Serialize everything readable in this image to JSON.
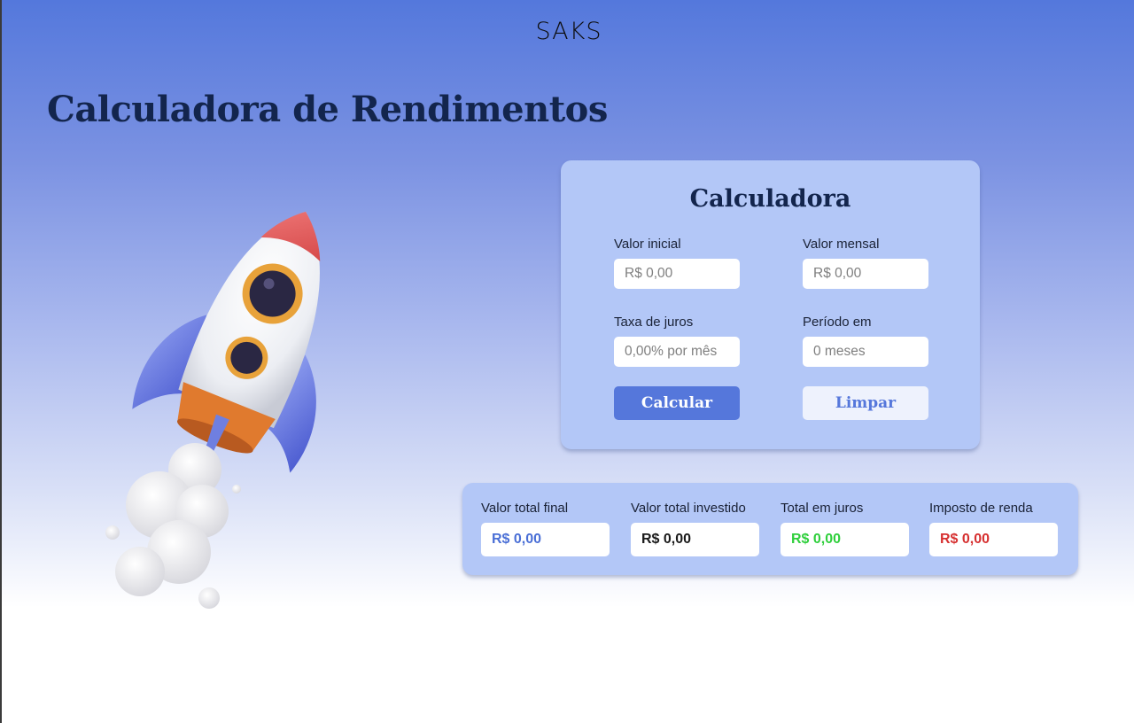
{
  "header": {
    "logo": "SAKS"
  },
  "page_title": "Calculadora de Rendimentos",
  "calculator": {
    "title": "Calculadora",
    "fields": [
      {
        "label": "Valor inicial",
        "placeholder": "R$ 0,00"
      },
      {
        "label": "Valor mensal",
        "placeholder": "R$ 0,00"
      },
      {
        "label": "Taxa de juros",
        "placeholder": "0,00% por mês"
      },
      {
        "label": "Período em",
        "placeholder": "0 meses"
      }
    ],
    "buttons": {
      "calculate": "Calcular",
      "clear": "Limpar"
    }
  },
  "results": [
    {
      "label": "Valor total final",
      "value": "R$ 0,00",
      "color": "#4a6fd6"
    },
    {
      "label": "Valor total investido",
      "value": "R$ 0,00",
      "color": "#1a1a1a"
    },
    {
      "label": "Total em juros",
      "value": "R$ 0,00",
      "color": "#2fcf3c"
    },
    {
      "label": "Imposto de renda",
      "value": "R$ 0,00",
      "color": "#d63030"
    }
  ],
  "illustration": {
    "icon": "rocket-icon"
  },
  "colors": {
    "title_text": "#13254d",
    "card_background": "#b3c7f7",
    "primary_button": "#5577db"
  }
}
